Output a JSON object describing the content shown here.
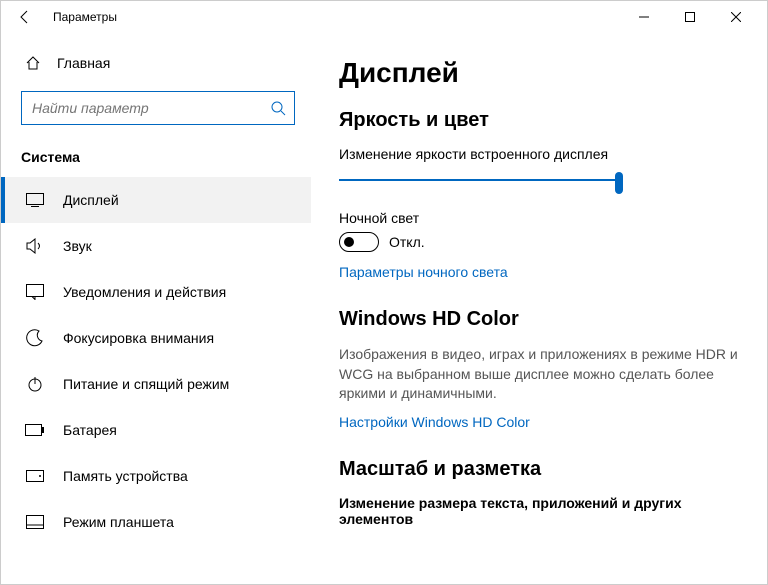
{
  "title": "Параметры",
  "sidebar": {
    "home": "Главная",
    "searchPlaceholder": "Найти параметр",
    "category": "Система",
    "items": [
      {
        "label": "Дисплей"
      },
      {
        "label": "Звук"
      },
      {
        "label": "Уведомления и действия"
      },
      {
        "label": "Фокусировка внимания"
      },
      {
        "label": "Питание и спящий режим"
      },
      {
        "label": "Батарея"
      },
      {
        "label": "Память устройства"
      },
      {
        "label": "Режим планшета"
      }
    ]
  },
  "main": {
    "heading": "Дисплей",
    "brightnessSection": "Яркость и цвет",
    "brightnessLabel": "Изменение яркости встроенного дисплея",
    "nightLight": "Ночной свет",
    "toggleOff": "Откл.",
    "nightLightLink": "Параметры ночного света",
    "hdHeading": "Windows HD Color",
    "hdDesc": "Изображения в видео, играх и приложениях в режиме HDR и WCG на выбранном выше дисплее можно сделать более яркими и динамичными.",
    "hdLink": "Настройки Windows HD Color",
    "scaleHeading": "Масштаб и разметка",
    "scaleLabel": "Изменение размера текста, приложений и других элементов"
  }
}
